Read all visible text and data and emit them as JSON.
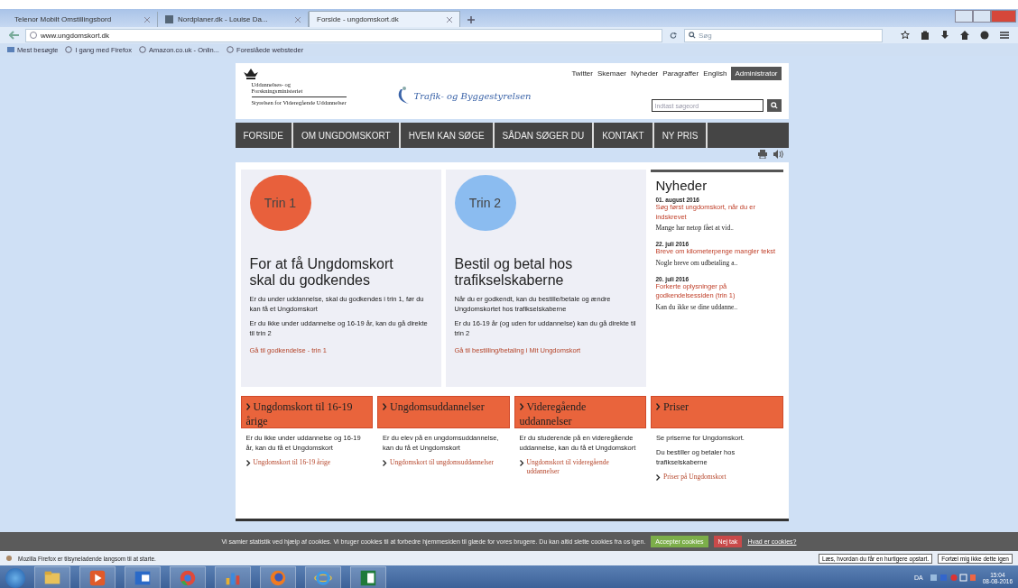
{
  "browser": {
    "tabs": [
      {
        "label": "Telenor Mobilt Omstillingsbord",
        "selected": false,
        "favicon": false
      },
      {
        "label": "Nordplaner.dk - Louise Da...",
        "selected": false,
        "favicon": true
      },
      {
        "label": "Forside - ungdomskort.dk",
        "selected": true,
        "favicon": false
      }
    ],
    "url": "www.ungdomskort.dk",
    "search_placeholder": "Søg",
    "bookmarks": [
      "Mest besøgte",
      "I gang med Firefox",
      "Amazon.co.uk - Onlin...",
      "Foreslåede websteder"
    ]
  },
  "site": {
    "top_links": [
      "Twitter",
      "Skemaer",
      "Nyheder",
      "Paragraffer",
      "English"
    ],
    "admin_button": "Administrator",
    "ministry": [
      "Uddannelses- og",
      "Forskningsministeriet",
      "Styrelsen for Videregående Uddannelser"
    ],
    "agency": "Trafik- og Byggestyrelsen",
    "search_placeholder": "Indtast søgeord",
    "nav": [
      "FORSIDE",
      "OM UNGDOMSKORT",
      "HVEM KAN SØGE",
      "SÅDAN SØGER DU",
      "KONTAKT",
      "NY PRIS"
    ],
    "steps": [
      {
        "badge": "Trin 1",
        "color": "#e8603c",
        "title": "For at få Ungdomskort skal du godkendes",
        "paragraphs": [
          "Er du under uddannelse, skal du godkendes i trin 1, før du kan få et Ungdomskort",
          "Er du ikke under uddannelse og 16-19 år, kan du gå direkte til trin 2"
        ],
        "link": "Gå til godkendelse - trin 1"
      },
      {
        "badge": "Trin 2",
        "color": "#8bbcf0",
        "title": "Bestil og betal hos trafikselskaberne",
        "paragraphs": [
          "Når du er godkendt, kan du bestille/betale og ændre Ungdomskortet hos trafikselskaberne",
          "Er du 16-19 år (og uden for uddannelse) kan du gå direkte til trin 2"
        ],
        "link": "Gå til bestilling/betaling i Mit Ungdomskort"
      }
    ],
    "news": {
      "title": "Nyheder",
      "items": [
        {
          "date": "01. august 2016",
          "headline": "Søg først ungdomskort, når du er indskrevet",
          "teaser": "Mange har netop fået at vid.."
        },
        {
          "date": "22. juli 2016",
          "headline": "Breve om kilometerpenge mangler tekst",
          "teaser": "Nogle breve om udbetaling a.."
        },
        {
          "date": "20. juli 2016",
          "headline": "Forkerte oplysninger på godkendelsessiden (trin 1)",
          "teaser": "Kan du ikke se dine uddanne.."
        }
      ]
    },
    "boxes": [
      {
        "title": "Ungdomskort til 16-19 årige",
        "paragraphs": [
          "Er du ikke under uddannelse og 16-19 år, kan du få et Ungdomskort"
        ],
        "link": "Ungdomskort til 16-19 årige"
      },
      {
        "title": "Ungdomsuddannelser",
        "paragraphs": [
          "Er du elev på en ungdomsuddannelse, kan du få et Ungdomskort"
        ],
        "link": "Ungdomskort til ungdomsuddannelser"
      },
      {
        "title": "Videregående uddannelser",
        "paragraphs": [
          "Er du studerende på en videregående uddannelse, kan du få et Ungdomskort"
        ],
        "link": "Ungdomskort til videregående uddannelser"
      },
      {
        "title": "Priser",
        "paragraphs": [
          "Se priserne for Ungdomskort.",
          "Du bestiller og betaler hos trafikselskaberne"
        ],
        "link": "Priser på Ungdomskort"
      }
    ]
  },
  "cookie_bar": {
    "text": "Vi samler statistik ved hjælp af cookies. Vi bruger cookies til at forbedre hjemmesiden til glæde for vores brugere. Du kan altid slette cookies fra os igen.",
    "accept": "Accepter cookies",
    "decline": "Nej tak",
    "more": "Hvad er cookies?"
  },
  "notification": {
    "text": "Mozilla Firefox er tilsyneladende langsom til at starte.",
    "buttons": [
      "Læs, hvordan du får en hurtigere opstart.",
      "Fortæl mig ikke dette igen"
    ]
  },
  "taskbar": {
    "apps": [
      {
        "kind": "folder"
      },
      {
        "kind": "media"
      },
      {
        "kind": "outlook"
      },
      {
        "kind": "chrome"
      },
      {
        "kind": "paint"
      },
      {
        "kind": "firefox"
      },
      {
        "kind": "ie"
      },
      {
        "kind": "excel"
      }
    ],
    "language": "DA",
    "time": "15:04",
    "date": "08-08-2016"
  }
}
